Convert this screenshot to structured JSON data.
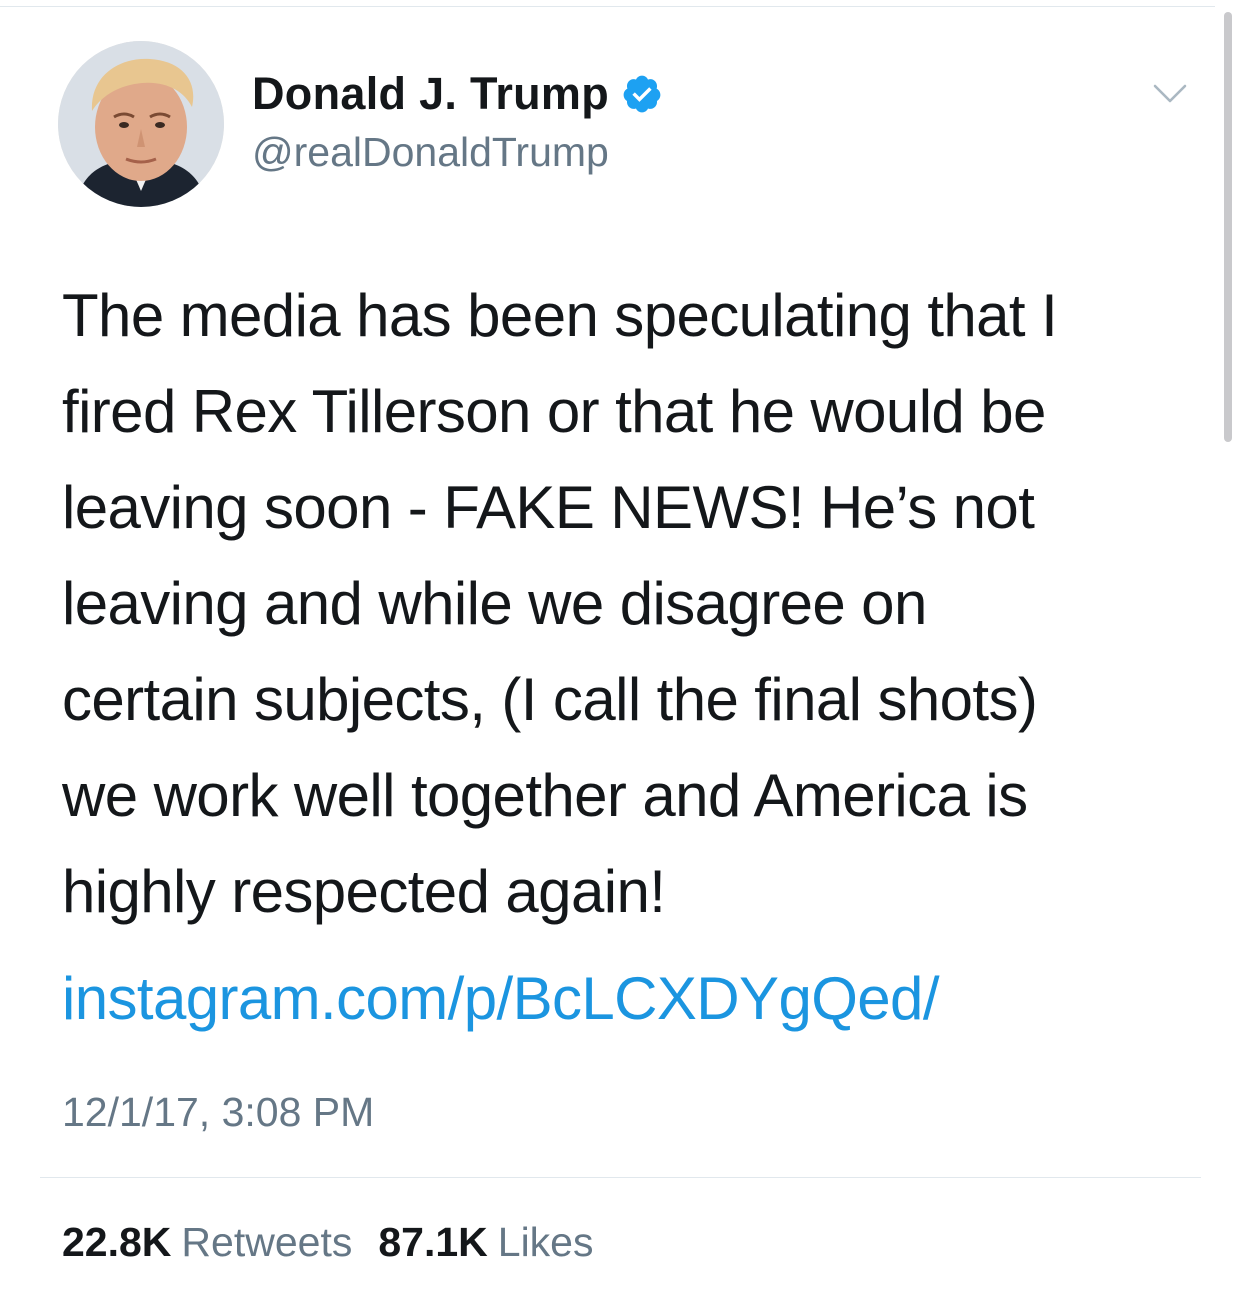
{
  "author": {
    "display_name": "Donald J. Trump",
    "handle": "@realDonaldTrump",
    "verified": true,
    "verified_color": "#1da1f2"
  },
  "tweet": {
    "lines": [
      "The media has been speculating that I",
      "fired Rex Tillerson or that he would be",
      "leaving soon - FAKE NEWS! He’s not",
      "leaving and while we disagree on",
      "certain subjects, (I call the final shots)",
      "we work well together and America is",
      "highly respected again!"
    ],
    "link": "instagram.com/p/BcLCXDYgQed/",
    "link_color": "#1b95e0",
    "timestamp": "12/1/17, 3:08 PM"
  },
  "stats": {
    "retweets_count": "22.8K",
    "retweets_label": "Retweets",
    "likes_count": "87.1K",
    "likes_label": "Likes"
  },
  "icons": {
    "menu": "chevron-down-icon",
    "verified": "verified-badge-icon"
  }
}
